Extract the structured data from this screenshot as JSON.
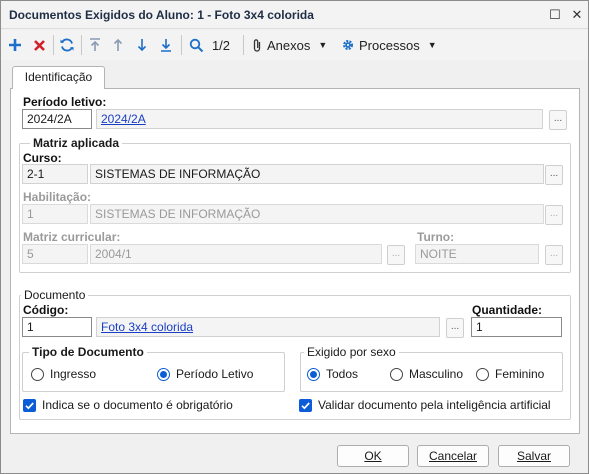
{
  "window": {
    "title": "Documentos Exigidos do Aluno: 1 - Foto 3x4 colorida",
    "maximize_glyph": "☐",
    "close_glyph": "✕"
  },
  "toolbar": {
    "icons": [
      "add-icon",
      "delete-icon",
      "refresh-icon",
      "first-record-icon",
      "previous-record-icon",
      "next-record-icon",
      "last-record-icon",
      "search-icon",
      "attachment-icon",
      "gear-icon"
    ],
    "page_indicator": "1/2",
    "anexos_label": "Anexos",
    "processos_label": "Processos",
    "caret": "▼"
  },
  "tabs": [
    {
      "label": "Identificação",
      "active": true
    }
  ],
  "periodo": {
    "label": "Período letivo:",
    "code": "2024/2A",
    "link": "2024/2A",
    "lookup": "..."
  },
  "matriz": {
    "title": "Matriz aplicada",
    "curso_label": "Curso:",
    "curso_code": "2-1",
    "curso_name": "SISTEMAS DE INFORMAÇÃO",
    "habilitacao_label": "Habilitação:",
    "habilitacao_code": "1",
    "habilitacao_name": "SISTEMAS DE INFORMAÇÃO",
    "matriz_label": "Matriz curricular:",
    "matriz_code": "5",
    "matriz_name": "2004/1",
    "turno_label": "Turno:",
    "turno_value": "NOITE",
    "lookup": "..."
  },
  "documento": {
    "title": "Documento",
    "codigo_label": "Código:",
    "codigo_value": "1",
    "nome_link": "Foto 3x4 colorida",
    "lookup": "...",
    "quantidade_label": "Quantidade:",
    "quantidade_value": "1"
  },
  "tipo_documento": {
    "title": "Tipo de Documento",
    "options": [
      {
        "label": "Ingresso",
        "selected": false
      },
      {
        "label": "Período Letivo",
        "selected": true
      }
    ]
  },
  "exigido_sexo": {
    "title": "Exigido por sexo",
    "options": [
      {
        "label": "Todos",
        "selected": true
      },
      {
        "label": "Masculino",
        "selected": false
      },
      {
        "label": "Feminino",
        "selected": false
      }
    ]
  },
  "checks": {
    "obrigatorio": "Indica se o documento é obrigatório",
    "validar_ia": "Validar documento pela inteligência artificial"
  },
  "buttons": {
    "ok": "OK",
    "cancelar": "Cancelar",
    "salvar": "Salvar"
  },
  "colors": {
    "accent": "#0b5cd6",
    "link": "#1a3fc4",
    "delete": "#d0202a",
    "add": "#1d6fc9"
  }
}
